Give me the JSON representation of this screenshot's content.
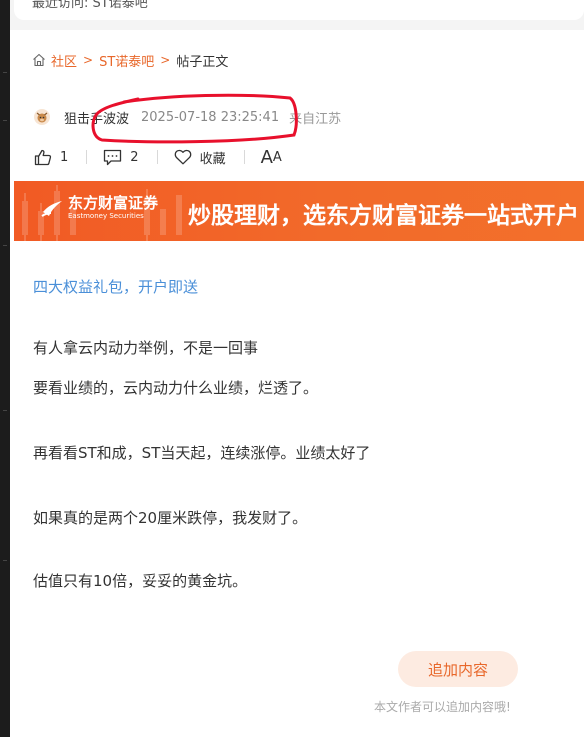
{
  "header": {
    "recent_visit": "最近访问: ST诺泰吧"
  },
  "breadcrumb": {
    "items": [
      "社区",
      "ST诺泰吧",
      "帖子正文"
    ]
  },
  "post": {
    "author": "狙击手波波",
    "time": "2025-07-18 23:25:41",
    "location": "来自江苏"
  },
  "actions": {
    "like_count": "1",
    "comment_count": "2",
    "favorite_label": "收藏",
    "font_size_label": "A"
  },
  "banner": {
    "brand": "东方财富证券",
    "brand_en": "Eastmoney Securities",
    "slogan": "炒股理财，选东方财富证券一站式开户"
  },
  "content": {
    "promo_link": "四大权益礼包，开户即送",
    "paragraphs": [
      "有人拿云内动力举例，不是一回事",
      "要看业绩的，云内动力什么业绩，烂透了。",
      "再看看ST和成，ST当天起，连续涨停。业绩太好了",
      "如果真的是两个20厘米跌停，我发财了。",
      "估值只有10倍，妥妥的黄金坑。"
    ]
  },
  "footer": {
    "add_content_label": "追加内容",
    "add_content_hint": "本文作者可以追加内容哦!"
  },
  "colors": {
    "accent": "#e8672a",
    "link": "#4a8fd8",
    "banner": "#f15a24",
    "annotation": "#e8102c"
  }
}
